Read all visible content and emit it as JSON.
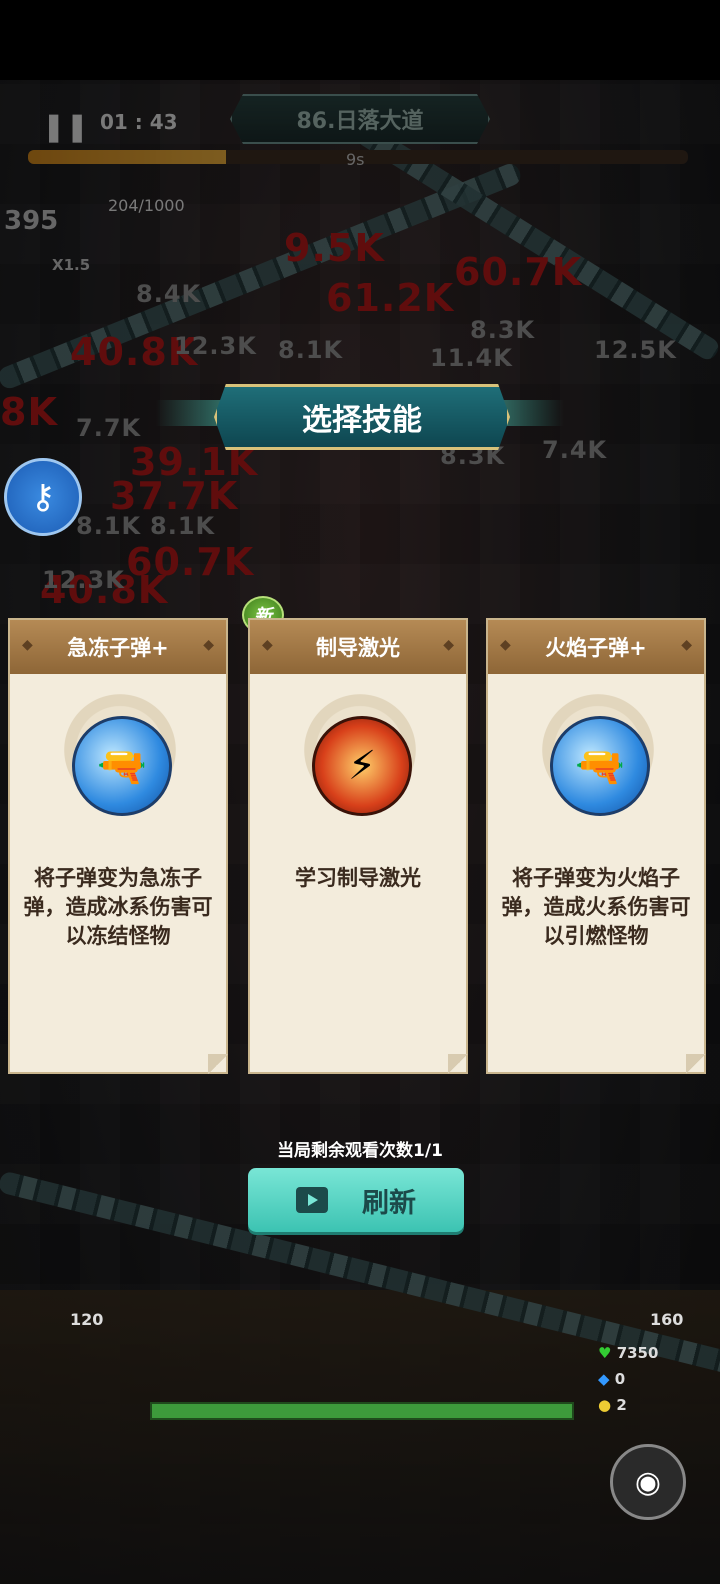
{
  "hud": {
    "pause": "❚❚",
    "time": "01 : 43",
    "level": "86.日落大道",
    "wave_countdown": "9s",
    "score": "395",
    "energy": "204/1000",
    "multiplier": "X1.5"
  },
  "damage_numbers": [
    "9.5K",
    "61.2K",
    "60.7K",
    "40.8K",
    "39.1K",
    "37.7K",
    "60.7K",
    "40.8K",
    "12.3K",
    "8.1K",
    "7.7K",
    "8.3K",
    "12.5K",
    "11.4K",
    "7.4K",
    "8.4K",
    "8.1K",
    "8.1K",
    "12.3K",
    "8.3K",
    "8K"
  ],
  "panel": {
    "title": "选择技能",
    "new_badge": "新",
    "cards": [
      {
        "name": "急冻子弹+",
        "desc": "将子弹变为急冻子弹，造成冰系伤害可以冻结怪物",
        "icon": "rifle-upgrade-icon"
      },
      {
        "name": "制导激光",
        "desc": "学习制导激光",
        "icon": "guided-laser-icon"
      },
      {
        "name": "火焰子弹+",
        "desc": "将子弹变为火焰子弹，造成火系伤害可以引燃怪物",
        "icon": "rifle-upgrade-icon"
      }
    ],
    "views_remaining": "当局剩余观看次数1/1",
    "refresh_label": "刷新"
  },
  "bottom": {
    "skill_left_value": "120",
    "skill_right_value": "160",
    "hp": "7350",
    "shield": "0",
    "coins": "2"
  },
  "colors": {
    "accent": "#3cc3b2",
    "card_header": "#8e6637",
    "damage_red": "#b01818"
  }
}
